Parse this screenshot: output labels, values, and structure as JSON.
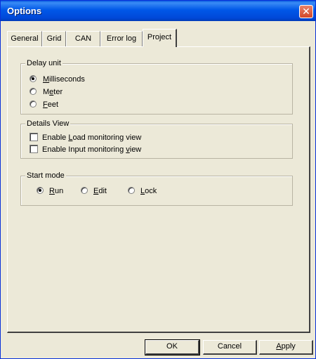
{
  "window": {
    "title": "Options",
    "close_glyph": "✕"
  },
  "tabs": [
    {
      "label": "General",
      "active": false
    },
    {
      "label": "Grid",
      "active": false
    },
    {
      "label": "CAN",
      "active": false
    },
    {
      "label": "Error log",
      "active": false
    },
    {
      "label": "Project",
      "active": true
    }
  ],
  "delay_unit": {
    "title": "Delay unit",
    "options": [
      {
        "pre": "",
        "key": "M",
        "post": "illiseconds",
        "selected": true
      },
      {
        "pre": "M",
        "key": "e",
        "post": "ter",
        "selected": false
      },
      {
        "pre": "",
        "key": "F",
        "post": "eet",
        "selected": false
      }
    ]
  },
  "details_view": {
    "title": "Details View",
    "options": [
      {
        "pre": "Enable ",
        "key": "L",
        "post": "oad monitoring view",
        "checked": false
      },
      {
        "pre": "Enable Input monitoring ",
        "key": "v",
        "post": "iew",
        "checked": false
      }
    ]
  },
  "start_mode": {
    "title": "Start mode",
    "options": [
      {
        "pre": "",
        "key": "R",
        "post": "un",
        "selected": true
      },
      {
        "pre": "",
        "key": "E",
        "post": "dit",
        "selected": false
      },
      {
        "pre": "",
        "key": "L",
        "post": "ock",
        "selected": false
      }
    ]
  },
  "buttons": {
    "ok": "OK",
    "cancel": "Cancel",
    "apply_pre": "",
    "apply_key": "A",
    "apply_post": "pply"
  }
}
